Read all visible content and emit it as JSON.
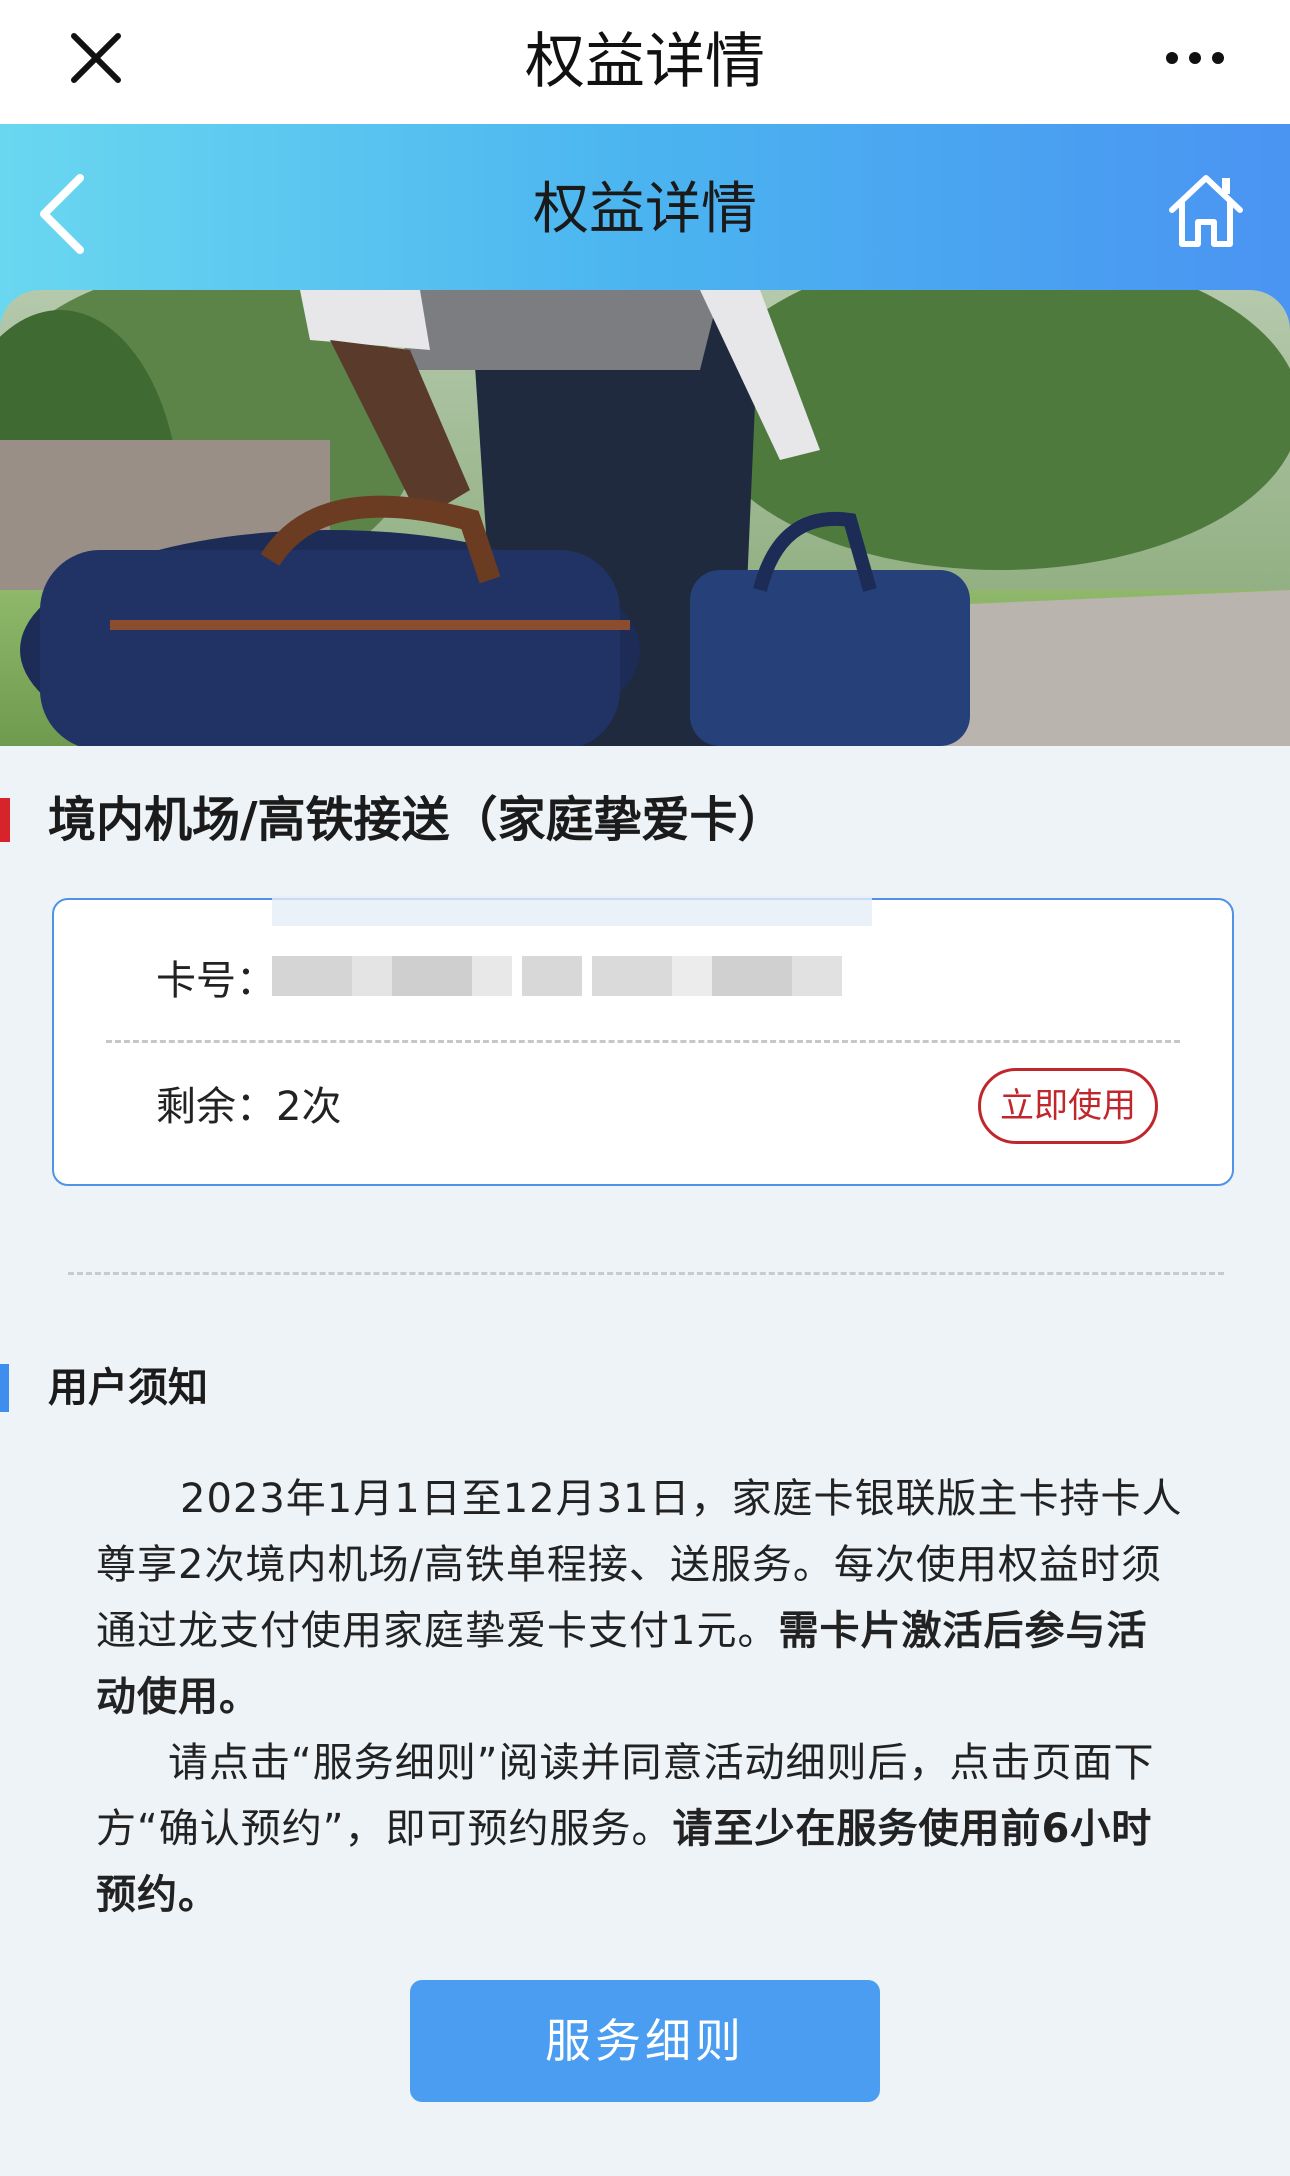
{
  "wechat_bar": {
    "title": "权益详情"
  },
  "header": {
    "title": "权益详情"
  },
  "benefit": {
    "title": "境内机场/高铁接送（家庭挚爱卡）"
  },
  "card": {
    "number_label": "卡号：",
    "remaining_label": "剩余：",
    "remaining_value": "2次",
    "use_button": "立即使用"
  },
  "notice": {
    "title": "用户须知",
    "para1_normal": "2023年1月1日至12月31日，家庭卡银联版主卡持卡人尊享2次境内机场/高铁单程接、送服务。每次使用权益时须通过龙支付使用家庭挚爱卡支付1元。",
    "para1_bold": "需卡片激活后参与活动使用。",
    "para2_normal": "请点击“服务细则”阅读并同意活动细则后，点击页面下方“确认预约”，即可预约服务。",
    "para2_bold": "请至少在服务使用前6小时预约。"
  },
  "service_button": "服务细则",
  "colors": {
    "accent_red": "#d7242a",
    "accent_blue": "#3e8ef0",
    "button_blue": "#4a9df0"
  }
}
